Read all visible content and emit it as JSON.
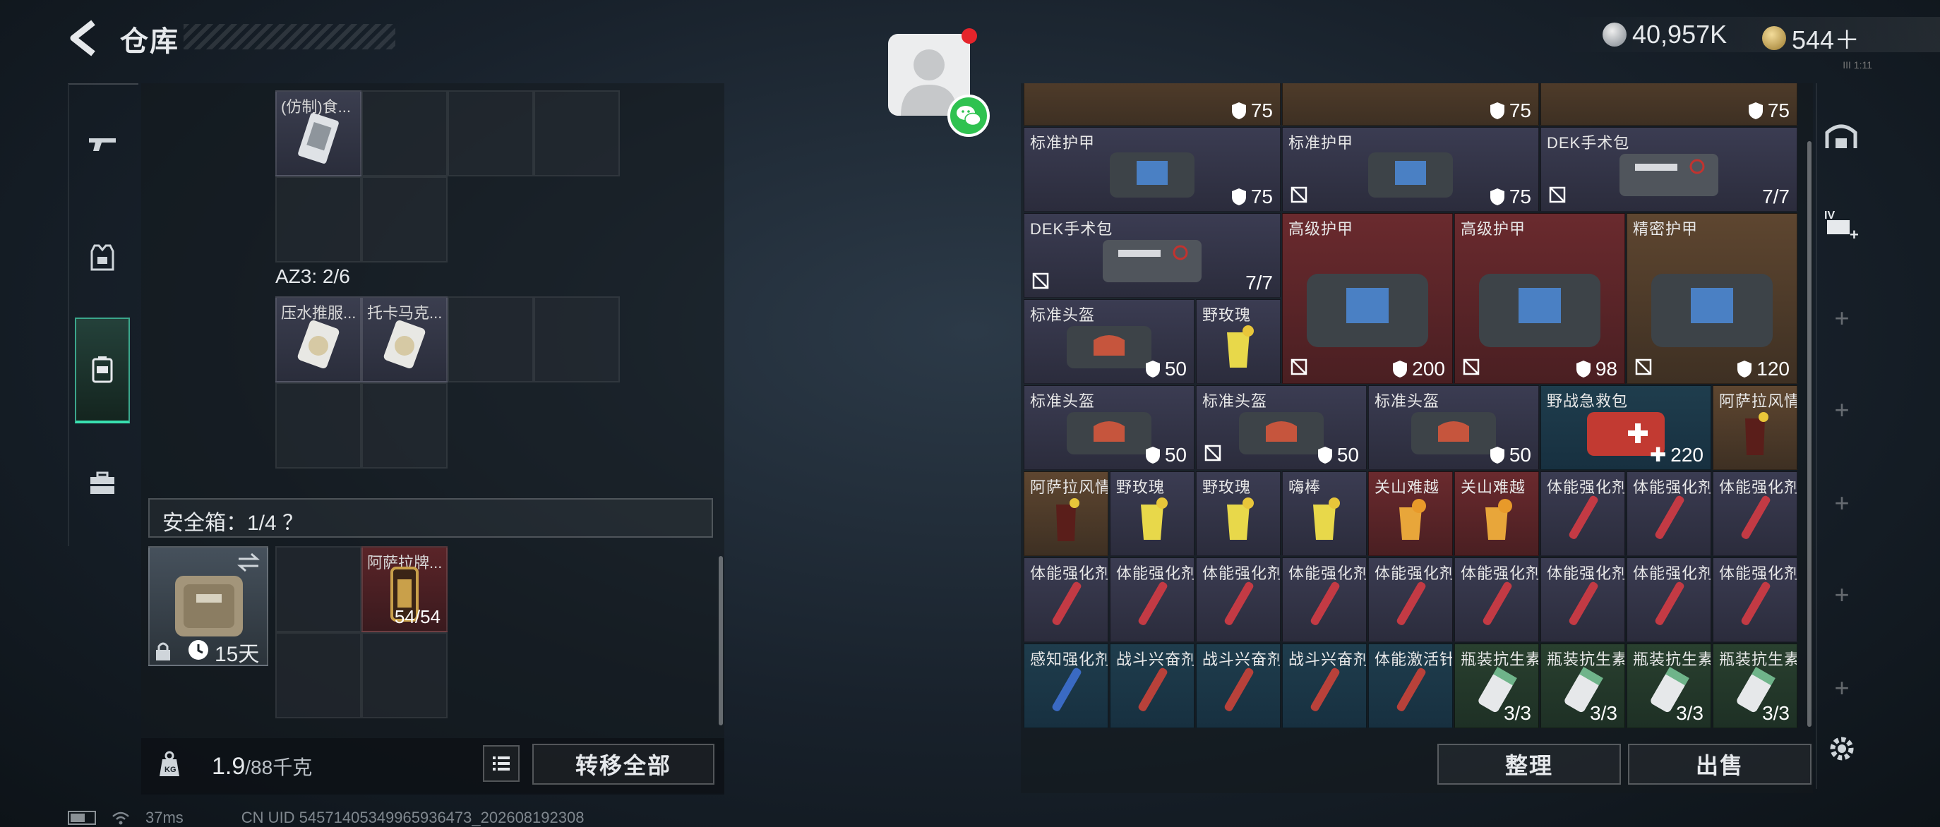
{
  "header": {
    "title": "仓库",
    "currency_silver": "40,957K",
    "currency_gold": "544＋",
    "tiny_text": "III 1:11"
  },
  "left_panel": {
    "top_item": {
      "label": "(仿制)食..."
    },
    "az3_label": "AZ3: 2/6",
    "az3_items": [
      {
        "label": "压水推服..."
      },
      {
        "label": "托卡马克..."
      }
    ],
    "safe_box_label": "安全箱：1/4 ？",
    "safe_case_duration": "15天",
    "safe_item": {
      "label": "阿萨拉牌...",
      "count": "54/54"
    },
    "weight_value": "1.9",
    "weight_max": "/88千克",
    "transfer_all_label": "转移全部"
  },
  "right_panel": {
    "row0": [
      {
        "count": "75"
      },
      {
        "count": "75"
      },
      {
        "count": "75"
      }
    ],
    "row1": [
      {
        "label": "标准护甲",
        "count": "75"
      },
      {
        "label": "标准护甲",
        "count": "75"
      },
      {
        "label": "DEK手术包",
        "count": "7/7"
      }
    ],
    "row2": [
      {
        "label": "DEK手术包",
        "count": "7/7"
      },
      {
        "label": "高级护甲",
        "count": "200"
      },
      {
        "label": "高级护甲",
        "count": "98"
      },
      {
        "label": "精密护甲",
        "count": "120"
      }
    ],
    "row2b": [
      {
        "label": "标准头盔",
        "count": "50"
      },
      {
        "label": "野玫瑰"
      }
    ],
    "row3": [
      {
        "label": "标准头盔",
        "count": "50"
      },
      {
        "label": "标准头盔",
        "count": "50"
      },
      {
        "label": "标准头盔",
        "count": "50"
      },
      {
        "label": "野战急救包",
        "count": "220"
      },
      {
        "label": "阿萨拉风情"
      }
    ],
    "row4": [
      {
        "label": "阿萨拉风情"
      },
      {
        "label": "野玫瑰"
      },
      {
        "label": "野玫瑰"
      },
      {
        "label": "嗨棒"
      },
      {
        "label": "关山难越"
      },
      {
        "label": "关山难越"
      },
      {
        "label": "体能强化剂"
      },
      {
        "label": "体能强化剂"
      },
      {
        "label": "体能强化剂"
      }
    ],
    "row5": [
      {
        "label": "体能强化剂"
      },
      {
        "label": "体能强化剂"
      },
      {
        "label": "体能强化剂"
      },
      {
        "label": "体能强化剂"
      },
      {
        "label": "体能强化剂"
      },
      {
        "label": "体能强化剂"
      },
      {
        "label": "体能强化剂"
      },
      {
        "label": "体能强化剂"
      },
      {
        "label": "体能强化剂"
      }
    ],
    "row6": [
      {
        "label": "感知强化剂"
      },
      {
        "label": "战斗兴奋剂"
      },
      {
        "label": "战斗兴奋剂"
      },
      {
        "label": "战斗兴奋剂"
      },
      {
        "label": "体能激活针"
      },
      {
        "label": "瓶装抗生素",
        "count": "3/3"
      },
      {
        "label": "瓶装抗生素",
        "count": "3/3"
      },
      {
        "label": "瓶装抗生素",
        "count": "3/3"
      },
      {
        "label": "瓶装抗生素",
        "count": "3/3"
      }
    ],
    "sort_label": "整理",
    "sell_label": "出售"
  },
  "footer": {
    "ping": "37ms",
    "uid": "CN UID 5457140534996593647​3_202608192308"
  },
  "colors": {
    "accent_green": "#39e0b0",
    "quality_purple": "#3b3c52",
    "quality_red": "#6a2a2e",
    "quality_gold": "#5e4630",
    "quality_blue": "#1f3d4d",
    "quality_green": "#29402f"
  }
}
